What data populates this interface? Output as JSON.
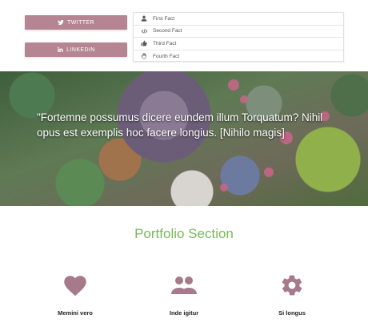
{
  "social": {
    "twitter_label": "TWITTER",
    "linkedin_label": "LINKEDIN",
    "button_color": "#b58594"
  },
  "facts": [
    {
      "label": "First Fact",
      "icon": "user-icon"
    },
    {
      "label": "Second Fact",
      "icon": "code-icon"
    },
    {
      "label": "Third Fact",
      "icon": "thumbs-up-icon"
    },
    {
      "label": "Fourth Fact",
      "icon": "hand-icon"
    }
  ],
  "hero": {
    "quote": "\"Fortemne possumus dicere eundem illum Torquatum? Nihil opus est exemplis hoc facere longius. [Nihilo magis]"
  },
  "portfolio": {
    "title": "Portfolio Section",
    "title_color": "#7ab85a",
    "icon_color": "#a67a8a",
    "items": [
      {
        "label": "Memini vero",
        "icon": "heart-icon"
      },
      {
        "label": "Inde igitur",
        "icon": "group-icon"
      },
      {
        "label": "Si longus",
        "icon": "gear-icon"
      }
    ]
  }
}
